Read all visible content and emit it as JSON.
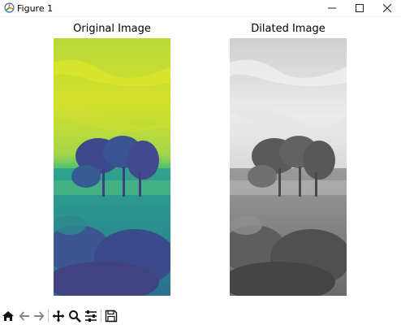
{
  "window": {
    "title": "Figure 1",
    "icons": [
      "figure-app-icon",
      "minimize-icon",
      "maximize-icon",
      "close-icon"
    ]
  },
  "figure": {
    "subplots": [
      {
        "title": "Original Image",
        "colormap": "viridis"
      },
      {
        "title": "Dilated Image",
        "colormap": "gray"
      }
    ]
  },
  "toolbar": {
    "buttons": [
      {
        "icon": "home-icon"
      },
      {
        "icon": "back-arrow-icon"
      },
      {
        "icon": "forward-arrow-icon"
      },
      {
        "icon": "pan-icon"
      },
      {
        "icon": "zoom-icon"
      },
      {
        "icon": "configure-subplots-icon"
      },
      {
        "icon": "save-icon"
      }
    ]
  },
  "colors": {
    "viridis_sky": "#c9de2f",
    "viridis_mid": "#2fa88c",
    "viridis_dark": "#3b3f85",
    "gray_sky": "#e6e6e6",
    "gray_dark": "#3a3a3a"
  }
}
